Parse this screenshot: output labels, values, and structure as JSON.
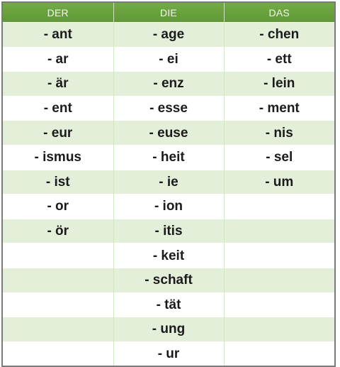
{
  "headers": [
    "DER",
    "DIE",
    "DAS"
  ],
  "rows": [
    [
      "- ant",
      "- age",
      "- chen"
    ],
    [
      "- ar",
      "- ei",
      "- ett"
    ],
    [
      "- är",
      "- enz",
      "- lein"
    ],
    [
      "- ent",
      "- esse",
      "- ment"
    ],
    [
      "- eur",
      "- euse",
      "- nis"
    ],
    [
      "- ismus",
      "- heit",
      "- sel"
    ],
    [
      "- ist",
      "- ie",
      "- um"
    ],
    [
      "- or",
      "- ion",
      ""
    ],
    [
      "- ör",
      "- itis",
      ""
    ],
    [
      "",
      "- keit",
      ""
    ],
    [
      "",
      "- schaft",
      ""
    ],
    [
      "",
      "- tät",
      ""
    ],
    [
      "",
      "- ung",
      ""
    ],
    [
      "",
      "- ur",
      ""
    ]
  ],
  "colors": {
    "header_green": "#6aa33e",
    "stripe_green": "#e4efda",
    "white": "#ffffff"
  }
}
